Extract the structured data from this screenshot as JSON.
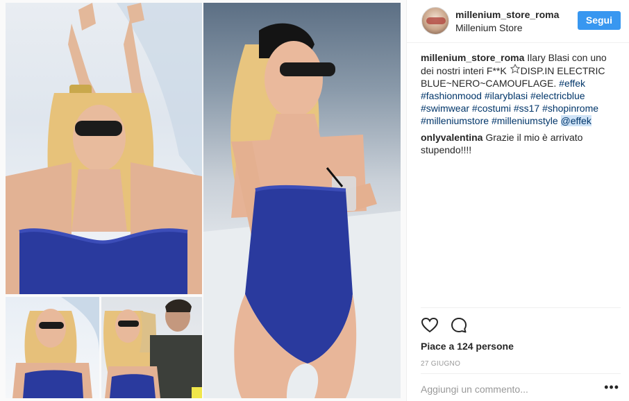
{
  "post": {
    "image_alt": "Ilary Blasi in electric blue strapless swimsuit collage"
  },
  "header": {
    "username": "millenium_store_roma",
    "full_name": "Millenium Store",
    "follow_label": "Segui"
  },
  "caption": {
    "username": "millenium_store_roma",
    "text_part1": "Ilary Blasi con uno dei nostri interi F**K",
    "top_badge": "TOP",
    "text_part2": "DISP.IN ELECTRIC BLUE~NERO~CAMOUFLAGE.",
    "hashtags": [
      "#effek",
      "#fashionmood",
      "#ilaryblasi",
      "#electricblue",
      "#swimwear",
      "#costumi",
      "#ss17",
      "#shopinrome",
      "#milleniumstore",
      "#milleniumstyle"
    ],
    "mention": "@effek"
  },
  "comment": {
    "username": "onlyvalentina",
    "text": "Grazie il mio è arrivato stupendo!!!!"
  },
  "actions": {
    "like_icon": "heart-icon",
    "comment_icon": "comment-bubble-icon",
    "likes_text": "Piace a 124 persone",
    "date": "27 GIUGNO"
  },
  "add_comment": {
    "placeholder": "Aggiungi un commento...",
    "more_label": "•••"
  },
  "colors": {
    "follow_button": "#3897f0",
    "hashtag": "#003569",
    "swimsuit": "#2a3a9e"
  }
}
